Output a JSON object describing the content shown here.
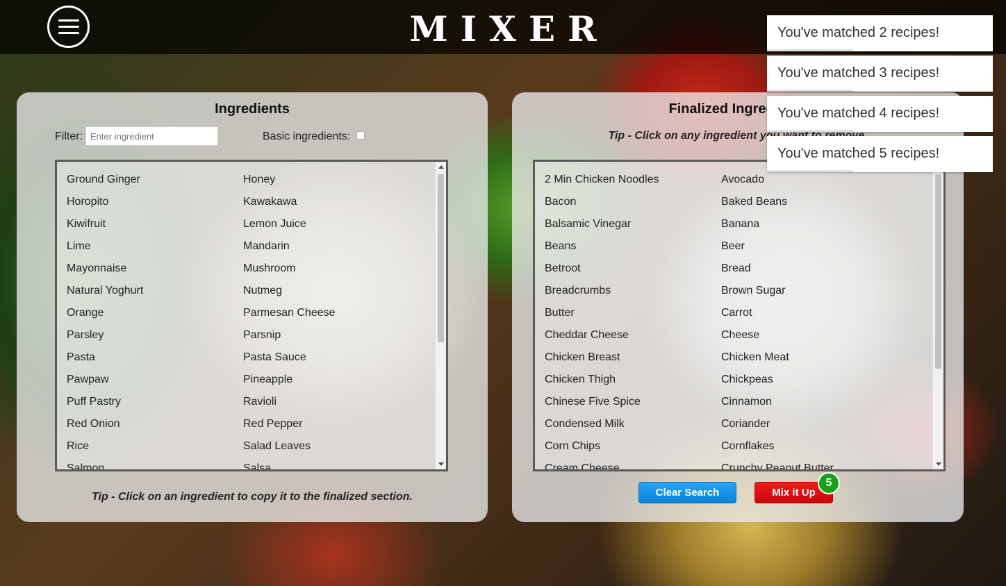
{
  "header": {
    "logo": "MIXER"
  },
  "ingredients_panel": {
    "title": "Ingredients",
    "filter_label": "Filter:",
    "filter_placeholder": "Enter ingredient",
    "basic_label": "Basic ingredients:",
    "basic_checked": false,
    "tip": "Tip - Click on an ingredient to copy it to the finalized section.",
    "items": [
      "Ground Ginger",
      "Honey",
      "Horopito",
      "Kawakawa",
      "Kiwifruit",
      "Lemon Juice",
      "Lime",
      "Mandarin",
      "Mayonnaise",
      "Mushroom",
      "Natural Yoghurt",
      "Nutmeg",
      "Orange",
      "Parmesan Cheese",
      "Parsley",
      "Parsnip",
      "Pasta",
      "Pasta Sauce",
      "Pawpaw",
      "Pineapple",
      "Puff Pastry",
      "Ravioli",
      "Red Onion",
      "Red Pepper",
      "Rice",
      "Salad Leaves",
      "Salmon",
      "Salsa"
    ]
  },
  "finalized_panel": {
    "title": "Finalized Ingredients",
    "tip": "Tip - Click on any ingredient you want to remove.",
    "items": [
      "2 Min Chicken Noodles",
      "Avocado",
      "Bacon",
      "Baked Beans",
      "Balsamic Vinegar",
      "Banana",
      "Beans",
      "Beer",
      "Betroot",
      "Bread",
      "Breadcrumbs",
      "Brown Sugar",
      "Butter",
      "Carrot",
      "Cheddar Cheese",
      "Cheese",
      "Chicken Breast",
      "Chicken Meat",
      "Chicken Thigh",
      "Chickpeas",
      "Chinese Five Spice",
      "Cinnamon",
      "Condensed Milk",
      "Coriander",
      "Corn Chips",
      "Cornflakes",
      "Cream Cheese",
      "Crunchy Peanut Butter"
    ],
    "clear_button": "Clear Search",
    "mix_button": "Mix it Up",
    "match_count": "5"
  },
  "toasts": [
    "You've matched 2 recipes!",
    "You've matched 3 recipes!",
    "You've matched 4 recipes!",
    "You've matched 5 recipes!"
  ],
  "colors": {
    "clear_button": "#0a82d8",
    "mix_button": "#d40808",
    "badge": "#16a116"
  },
  "icons": {
    "menu": "hamburger-menu-icon"
  }
}
